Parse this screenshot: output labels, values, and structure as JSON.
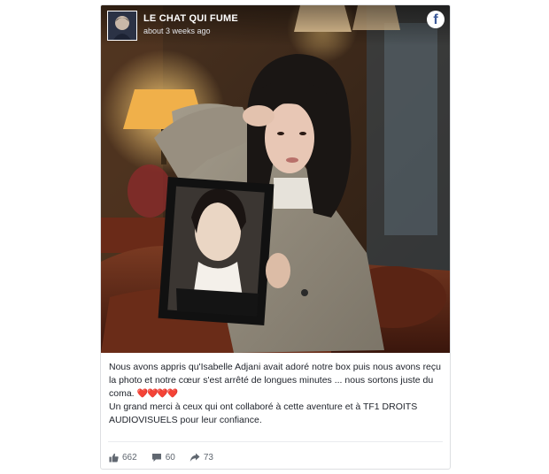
{
  "post": {
    "page_name": "LE CHAT QUI FUME",
    "timestamp": "about 3 weeks ago",
    "platform_icon": "facebook-icon",
    "caption_line1": "Nous avons appris qu'Isabelle Adjani avait adoré notre box puis nous avons reçu la photo et notre cœur s'est arrêté de longues minutes ... nous sortons juste du coma.",
    "hearts": "❤️❤️❤️❤️",
    "caption_line2": "Un grand merci à ceux qui ont collaboré à cette aventure et à TF1 DROITS AUDIOVISUELS pour leur confiance."
  },
  "stats": {
    "likes": "662",
    "comments": "60",
    "shares": "73"
  },
  "colors": {
    "brand": "#3b5998",
    "heart": "#e0245e",
    "text": "#1d2129",
    "muted": "#606770"
  }
}
